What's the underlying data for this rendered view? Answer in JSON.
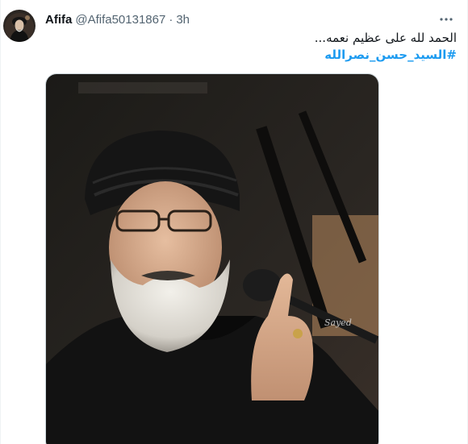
{
  "tweet": {
    "display_name": "Afifa",
    "handle": "@Afifa50131867",
    "separator": "·",
    "time": "3h",
    "more_icon": "more-horizontal-icon",
    "text_line": "الحمد لله على عظيم نعمه...",
    "hashtag": "#السيد_حسن_نصرالله"
  },
  "media": {
    "type": "photo",
    "watermark": "Sayed"
  },
  "colors": {
    "text": "#0f1419",
    "secondary": "#536471",
    "link": "#1d9bf0",
    "border": "#cfd9de"
  }
}
